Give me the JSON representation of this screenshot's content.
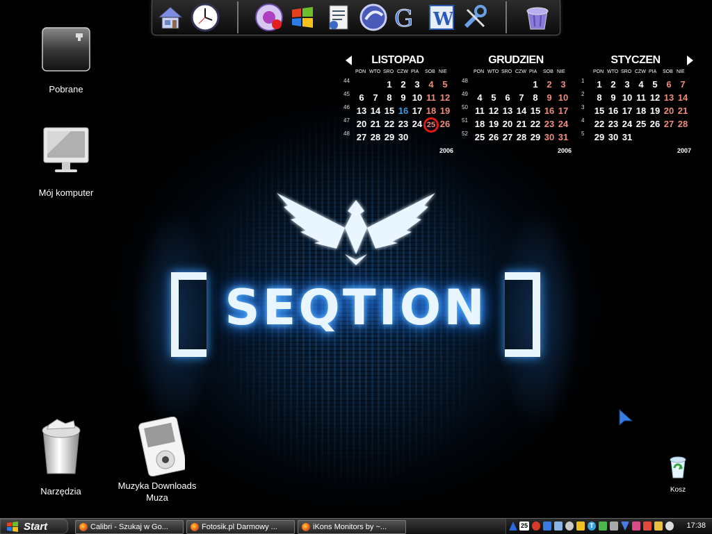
{
  "desktop": {
    "wallpaper_text": "SEQTION",
    "icons": [
      {
        "label": "Pobrane"
      },
      {
        "label": "Mój komputer"
      },
      {
        "label": "Narzędzia"
      },
      {
        "label": "Muzyka Downloads Muza"
      },
      {
        "label": "Kosz"
      }
    ]
  },
  "dock": {
    "icons": [
      "home-icon",
      "clock-icon",
      "itunes-icon",
      "windows-icon",
      "document-icon",
      "browser-icon",
      "google-icon",
      "word-icon",
      "tools-icon",
      "recycle-bin-icon"
    ]
  },
  "calendars": [
    {
      "month": "LISTOPAD",
      "year": "2006",
      "day_headers": [
        "PON",
        "WTO",
        "SRO",
        "CZW",
        "PIA",
        "SOB",
        "NIE"
      ],
      "weeks": [
        {
          "num": "44",
          "days": [
            "",
            "",
            "1",
            "2",
            "3",
            "4",
            "5"
          ]
        },
        {
          "num": "45",
          "days": [
            "6",
            "7",
            "8",
            "9",
            "10",
            "11",
            "12"
          ]
        },
        {
          "num": "46",
          "days": [
            "13",
            "14",
            "15",
            "16",
            "17",
            "18",
            "19"
          ]
        },
        {
          "num": "47",
          "days": [
            "20",
            "21",
            "22",
            "23",
            "24",
            "25",
            "26"
          ]
        },
        {
          "num": "48",
          "days": [
            "27",
            "28",
            "29",
            "30",
            "",
            "",
            ""
          ]
        }
      ],
      "today": "25",
      "highlight": "16"
    },
    {
      "month": "GRUDZIEN",
      "year": "2006",
      "day_headers": [
        "PON",
        "WTO",
        "SRO",
        "CZW",
        "PIA",
        "SOB",
        "NIE"
      ],
      "weeks": [
        {
          "num": "48",
          "days": [
            "",
            "",
            "",
            "",
            "1",
            "2",
            "3"
          ]
        },
        {
          "num": "49",
          "days": [
            "4",
            "5",
            "6",
            "7",
            "8",
            "9",
            "10"
          ]
        },
        {
          "num": "50",
          "days": [
            "11",
            "12",
            "13",
            "14",
            "15",
            "16",
            "17"
          ]
        },
        {
          "num": "51",
          "days": [
            "18",
            "19",
            "20",
            "21",
            "22",
            "23",
            "24"
          ]
        },
        {
          "num": "52",
          "days": [
            "25",
            "26",
            "27",
            "28",
            "29",
            "30",
            "31"
          ]
        }
      ]
    },
    {
      "month": "STYCZEN",
      "year": "2007",
      "day_headers": [
        "PON",
        "WTO",
        "SRO",
        "CZW",
        "PIA",
        "SOB",
        "NIE"
      ],
      "weeks": [
        {
          "num": "1",
          "days": [
            "1",
            "2",
            "3",
            "4",
            "5",
            "6",
            "7"
          ]
        },
        {
          "num": "2",
          "days": [
            "8",
            "9",
            "10",
            "11",
            "12",
            "13",
            "14"
          ]
        },
        {
          "num": "3",
          "days": [
            "15",
            "16",
            "17",
            "18",
            "19",
            "20",
            "21"
          ]
        },
        {
          "num": "4",
          "days": [
            "22",
            "23",
            "24",
            "25",
            "26",
            "27",
            "28"
          ]
        },
        {
          "num": "5",
          "days": [
            "29",
            "30",
            "31",
            "",
            "",
            "",
            ""
          ]
        }
      ]
    }
  ],
  "taskbar": {
    "start_label": "Start",
    "tasks": [
      {
        "label": "Calibri - Szukaj w Go..."
      },
      {
        "label": "Fotosik.pl Darmowy ..."
      },
      {
        "label": "iKons Monitors by ~..."
      }
    ],
    "tray_date_badge": "25",
    "clock": "17:38"
  },
  "colors": {
    "weekend": "#f08a7c",
    "highlight": "#3aa0e8",
    "today_ring": "#e01818",
    "glow": "#3c9cff"
  }
}
